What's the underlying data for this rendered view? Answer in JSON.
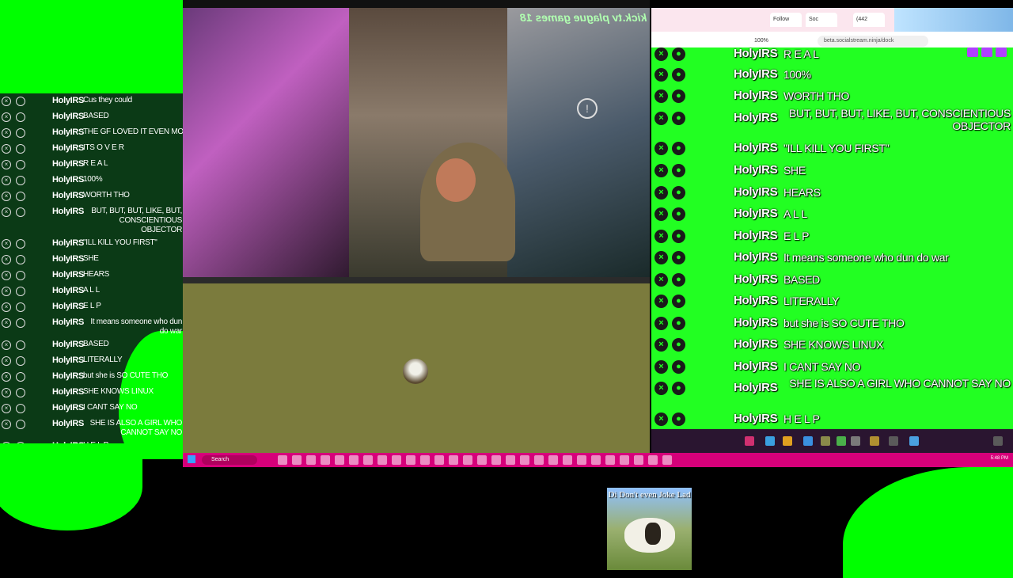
{
  "left_chat": {
    "rows": [
      {
        "user": "HolyIRS",
        "msg": "Cus they could"
      },
      {
        "user": "HolyIRS",
        "msg": "BASED"
      },
      {
        "user": "HolyIRS",
        "msg": "THE GF LOVED IT EVEN MORE"
      },
      {
        "user": "HolyIRS",
        "msg": "ITS O V E R"
      },
      {
        "user": "HolyIRS",
        "msg": "R E A L"
      },
      {
        "user": "HolyIRS",
        "msg": "100%"
      },
      {
        "user": "HolyIRS",
        "msg": "WORTH THO"
      },
      {
        "user": "HolyIRS",
        "msg": "BUT, BUT, BUT, LIKE, BUT, CONSCIENTIOUS OBJECTOR"
      },
      {
        "user": "HolyIRS",
        "msg": "\"ILL KILL YOU FIRST\""
      },
      {
        "user": "HolyIRS",
        "msg": "SHE"
      },
      {
        "user": "HolyIRS",
        "msg": "HEARS"
      },
      {
        "user": "HolyIRS",
        "msg": "A L L"
      },
      {
        "user": "HolyIRS",
        "msg": "E L P"
      },
      {
        "user": "HolyIRS",
        "msg": "It means someone who dun do war"
      },
      {
        "user": "HolyIRS",
        "msg": "BASED"
      },
      {
        "user": "HolyIRS",
        "msg": "LITERALLY"
      },
      {
        "user": "HolyIRS",
        "msg": "but she is SO CUTE THO"
      },
      {
        "user": "HolyIRS",
        "msg": "SHE KNOWS LINUX"
      },
      {
        "user": "HolyIRS",
        "msg": "I CANT SAY NO"
      },
      {
        "user": "HolyIRS",
        "msg": "SHE IS ALSO A GIRL WHO CANNOT SAY NO"
      },
      {
        "user": "HolyIRS",
        "msg": "H E L P"
      }
    ]
  },
  "cam": {
    "overlay_text": "kick.tv plague games 18"
  },
  "taskbar": {
    "search_label": "Search",
    "tray_time": "5:48 PM"
  },
  "browser": {
    "tabs": [
      "Follow",
      "Soc",
      "(442"
    ],
    "zoom": "100%",
    "url": "beta.socialstream.ninja/dock"
  },
  "right_chat": {
    "rows": [
      {
        "user": "HolyIRS",
        "msg": "R E A L"
      },
      {
        "user": "HolyIRS",
        "msg": "100%"
      },
      {
        "user": "HolyIRS",
        "msg": "WORTH THO"
      },
      {
        "user": "HolyIRS",
        "msg": "BUT, BUT, BUT, LIKE, BUT, CONSCIENTIOUS OBJECTOR"
      },
      {
        "user": "HolyIRS",
        "msg": "\"ILL KILL YOU FIRST\""
      },
      {
        "user": "HolyIRS",
        "msg": "SHE"
      },
      {
        "user": "HolyIRS",
        "msg": "HEARS"
      },
      {
        "user": "HolyIRS",
        "msg": "A L L"
      },
      {
        "user": "HolyIRS",
        "msg": "E L P"
      },
      {
        "user": "HolyIRS",
        "msg": "It means someone who dun do war"
      },
      {
        "user": "HolyIRS",
        "msg": "BASED"
      },
      {
        "user": "HolyIRS",
        "msg": "LITERALLY"
      },
      {
        "user": "HolyIRS",
        "msg": "but she is SO CUTE THO"
      },
      {
        "user": "HolyIRS",
        "msg": "SHE KNOWS LINUX"
      },
      {
        "user": "HolyIRS",
        "msg": "I CANT SAY NO"
      },
      {
        "user": "HolyIRS",
        "msg": "SHE IS ALSO A GIRL WHO CANNOT SAY NO"
      },
      {
        "user": "HolyIRS",
        "msg": "H E L P"
      }
    ]
  },
  "meme": {
    "caption": "Di Don't even Joke Lad"
  }
}
